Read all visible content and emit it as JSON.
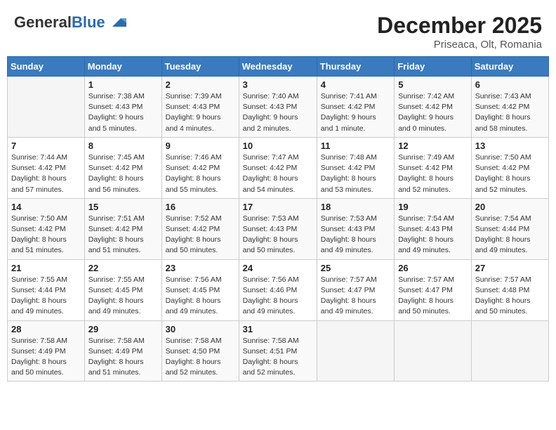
{
  "header": {
    "logo_general": "General",
    "logo_blue": "Blue",
    "month_title": "December 2025",
    "location": "Priseaca, Olt, Romania"
  },
  "days_of_week": [
    "Sunday",
    "Monday",
    "Tuesday",
    "Wednesday",
    "Thursday",
    "Friday",
    "Saturday"
  ],
  "weeks": [
    [
      {
        "day": "",
        "info": ""
      },
      {
        "day": "1",
        "info": "Sunrise: 7:38 AM\nSunset: 4:43 PM\nDaylight: 9 hours\nand 5 minutes."
      },
      {
        "day": "2",
        "info": "Sunrise: 7:39 AM\nSunset: 4:43 PM\nDaylight: 9 hours\nand 4 minutes."
      },
      {
        "day": "3",
        "info": "Sunrise: 7:40 AM\nSunset: 4:43 PM\nDaylight: 9 hours\nand 2 minutes."
      },
      {
        "day": "4",
        "info": "Sunrise: 7:41 AM\nSunset: 4:42 PM\nDaylight: 9 hours\nand 1 minute."
      },
      {
        "day": "5",
        "info": "Sunrise: 7:42 AM\nSunset: 4:42 PM\nDaylight: 9 hours\nand 0 minutes."
      },
      {
        "day": "6",
        "info": "Sunrise: 7:43 AM\nSunset: 4:42 PM\nDaylight: 8 hours\nand 58 minutes."
      }
    ],
    [
      {
        "day": "7",
        "info": "Sunrise: 7:44 AM\nSunset: 4:42 PM\nDaylight: 8 hours\nand 57 minutes."
      },
      {
        "day": "8",
        "info": "Sunrise: 7:45 AM\nSunset: 4:42 PM\nDaylight: 8 hours\nand 56 minutes."
      },
      {
        "day": "9",
        "info": "Sunrise: 7:46 AM\nSunset: 4:42 PM\nDaylight: 8 hours\nand 55 minutes."
      },
      {
        "day": "10",
        "info": "Sunrise: 7:47 AM\nSunset: 4:42 PM\nDaylight: 8 hours\nand 54 minutes."
      },
      {
        "day": "11",
        "info": "Sunrise: 7:48 AM\nSunset: 4:42 PM\nDaylight: 8 hours\nand 53 minutes."
      },
      {
        "day": "12",
        "info": "Sunrise: 7:49 AM\nSunset: 4:42 PM\nDaylight: 8 hours\nand 52 minutes."
      },
      {
        "day": "13",
        "info": "Sunrise: 7:50 AM\nSunset: 4:42 PM\nDaylight: 8 hours\nand 52 minutes."
      }
    ],
    [
      {
        "day": "14",
        "info": "Sunrise: 7:50 AM\nSunset: 4:42 PM\nDaylight: 8 hours\nand 51 minutes."
      },
      {
        "day": "15",
        "info": "Sunrise: 7:51 AM\nSunset: 4:42 PM\nDaylight: 8 hours\nand 51 minutes."
      },
      {
        "day": "16",
        "info": "Sunrise: 7:52 AM\nSunset: 4:42 PM\nDaylight: 8 hours\nand 50 minutes."
      },
      {
        "day": "17",
        "info": "Sunrise: 7:53 AM\nSunset: 4:43 PM\nDaylight: 8 hours\nand 50 minutes."
      },
      {
        "day": "18",
        "info": "Sunrise: 7:53 AM\nSunset: 4:43 PM\nDaylight: 8 hours\nand 49 minutes."
      },
      {
        "day": "19",
        "info": "Sunrise: 7:54 AM\nSunset: 4:43 PM\nDaylight: 8 hours\nand 49 minutes."
      },
      {
        "day": "20",
        "info": "Sunrise: 7:54 AM\nSunset: 4:44 PM\nDaylight: 8 hours\nand 49 minutes."
      }
    ],
    [
      {
        "day": "21",
        "info": "Sunrise: 7:55 AM\nSunset: 4:44 PM\nDaylight: 8 hours\nand 49 minutes."
      },
      {
        "day": "22",
        "info": "Sunrise: 7:55 AM\nSunset: 4:45 PM\nDaylight: 8 hours\nand 49 minutes."
      },
      {
        "day": "23",
        "info": "Sunrise: 7:56 AM\nSunset: 4:45 PM\nDaylight: 8 hours\nand 49 minutes."
      },
      {
        "day": "24",
        "info": "Sunrise: 7:56 AM\nSunset: 4:46 PM\nDaylight: 8 hours\nand 49 minutes."
      },
      {
        "day": "25",
        "info": "Sunrise: 7:57 AM\nSunset: 4:47 PM\nDaylight: 8 hours\nand 49 minutes."
      },
      {
        "day": "26",
        "info": "Sunrise: 7:57 AM\nSunset: 4:47 PM\nDaylight: 8 hours\nand 50 minutes."
      },
      {
        "day": "27",
        "info": "Sunrise: 7:57 AM\nSunset: 4:48 PM\nDaylight: 8 hours\nand 50 minutes."
      }
    ],
    [
      {
        "day": "28",
        "info": "Sunrise: 7:58 AM\nSunset: 4:49 PM\nDaylight: 8 hours\nand 50 minutes."
      },
      {
        "day": "29",
        "info": "Sunrise: 7:58 AM\nSunset: 4:49 PM\nDaylight: 8 hours\nand 51 minutes."
      },
      {
        "day": "30",
        "info": "Sunrise: 7:58 AM\nSunset: 4:50 PM\nDaylight: 8 hours\nand 52 minutes."
      },
      {
        "day": "31",
        "info": "Sunrise: 7:58 AM\nSunset: 4:51 PM\nDaylight: 8 hours\nand 52 minutes."
      },
      {
        "day": "",
        "info": ""
      },
      {
        "day": "",
        "info": ""
      },
      {
        "day": "",
        "info": ""
      }
    ]
  ]
}
